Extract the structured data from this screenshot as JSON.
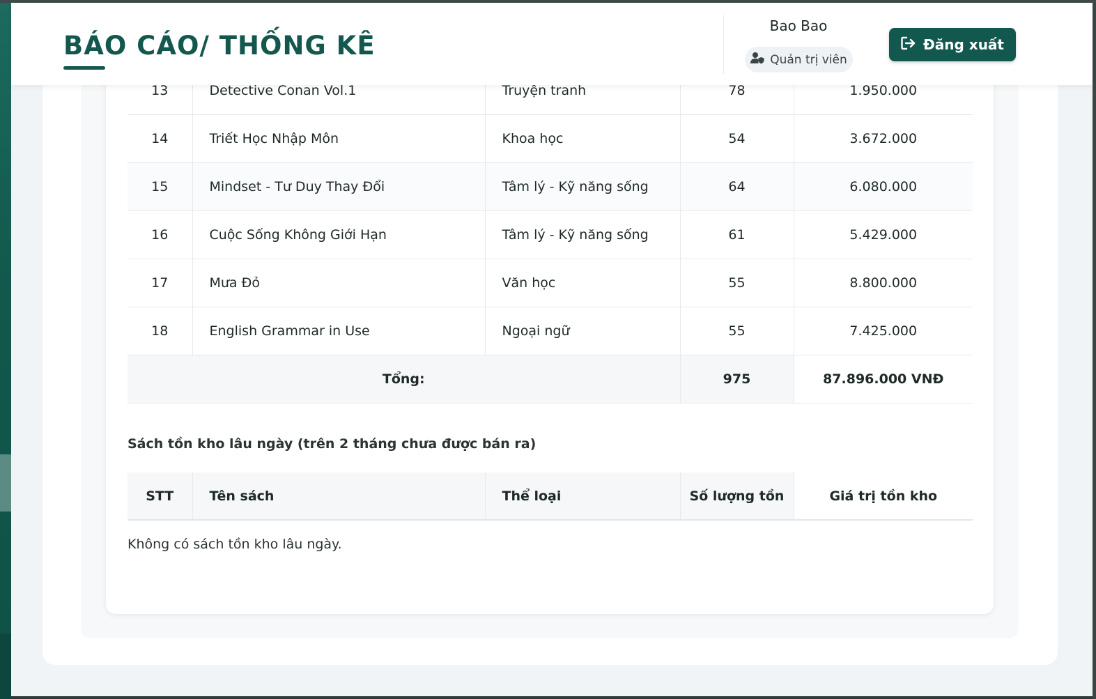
{
  "header": {
    "title": "BÁO CÁO/ THỐNG KÊ",
    "user_name": "Bao Bao",
    "role": "Quản trị viên",
    "logout_label": "Đăng xuất"
  },
  "inventory_table": {
    "rows": [
      {
        "stt": "13",
        "name": "Detective Conan Vol.1",
        "category": "Truyện tranh",
        "quantity": "78",
        "value": "1.950.000"
      },
      {
        "stt": "14",
        "name": "Triết Học Nhập Môn",
        "category": "Khoa học",
        "quantity": "54",
        "value": "3.672.000"
      },
      {
        "stt": "15",
        "name": "Mindset - Tư Duy Thay Đổi",
        "category": "Tâm lý - Kỹ năng sống",
        "quantity": "64",
        "value": "6.080.000"
      },
      {
        "stt": "16",
        "name": "Cuộc Sống Không Giới Hạn",
        "category": "Tâm lý - Kỹ năng sống",
        "quantity": "61",
        "value": "5.429.000"
      },
      {
        "stt": "17",
        "name": "Mưa Đỏ",
        "category": "Văn học",
        "quantity": "55",
        "value": "8.800.000"
      },
      {
        "stt": "18",
        "name": "English Grammar in Use",
        "category": "Ngoại ngữ",
        "quantity": "55",
        "value": "7.425.000"
      }
    ],
    "total_label": "Tổng:",
    "total_quantity": "975",
    "total_value": "87.896.000 VNĐ"
  },
  "old_stock": {
    "title": "Sách tồn kho lâu ngày (trên 2 tháng chưa được bán ra)",
    "headers": [
      "STT",
      "Tên sách",
      "Thể loại",
      "Số lượng tồn",
      "Giá trị tồn kho"
    ],
    "empty_message": "Không có sách tồn kho lâu ngày."
  },
  "colors": {
    "primary": "#13584f",
    "background": "#f1f4f7",
    "card": "#ffffff"
  }
}
